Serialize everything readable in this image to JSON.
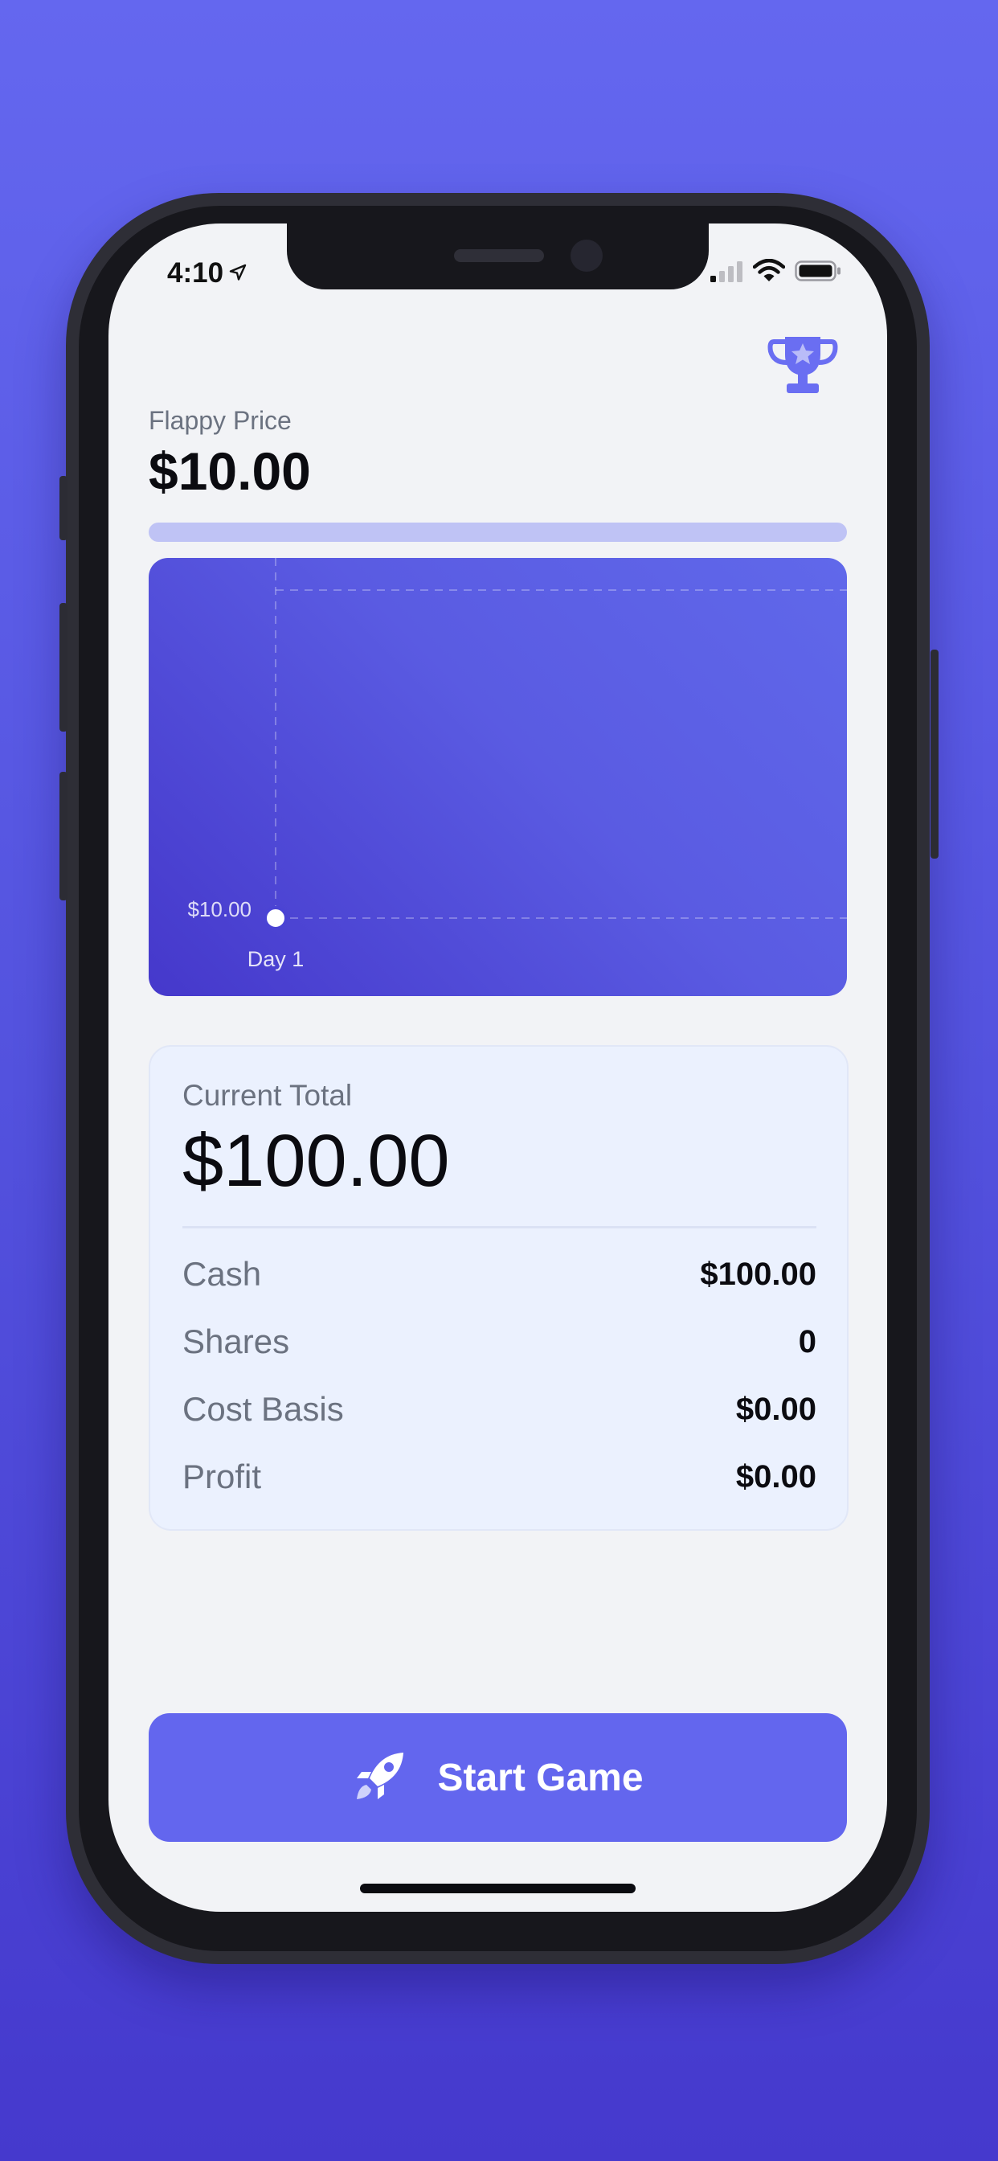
{
  "status_bar": {
    "time": "4:10",
    "location_icon": "location-arrow-icon",
    "signal_icon": "cellular-signal-icon",
    "wifi_icon": "wifi-icon",
    "battery_icon": "battery-icon"
  },
  "header": {
    "trophy_icon": "trophy-icon",
    "price_label": "Flappy Price",
    "price_value": "$10.00"
  },
  "progress": {
    "fraction": 0
  },
  "chart_data": {
    "type": "line",
    "x": [
      "Day 1"
    ],
    "y": [
      10.0
    ],
    "point_labels": [
      "$10.00"
    ],
    "tick_labels_x": [
      "Day 1"
    ],
    "grid": "dashed",
    "title": "",
    "xlabel": "",
    "ylabel": ""
  },
  "summary": {
    "total_label": "Current Total",
    "total_value": "$100.00",
    "rows": [
      {
        "label": "Cash",
        "value": "$100.00"
      },
      {
        "label": "Shares",
        "value": "0"
      },
      {
        "label": "Cost Basis",
        "value": "$0.00"
      },
      {
        "label": "Profit",
        "value": "$0.00"
      }
    ]
  },
  "start_button": {
    "label": "Start Game",
    "icon": "rocket-icon"
  },
  "colors": {
    "background": "#5352de",
    "accent": "#6366ee",
    "chart_card": "#4f4bd9",
    "card": "#ebf1fe",
    "screen": "#f2f3f6"
  }
}
